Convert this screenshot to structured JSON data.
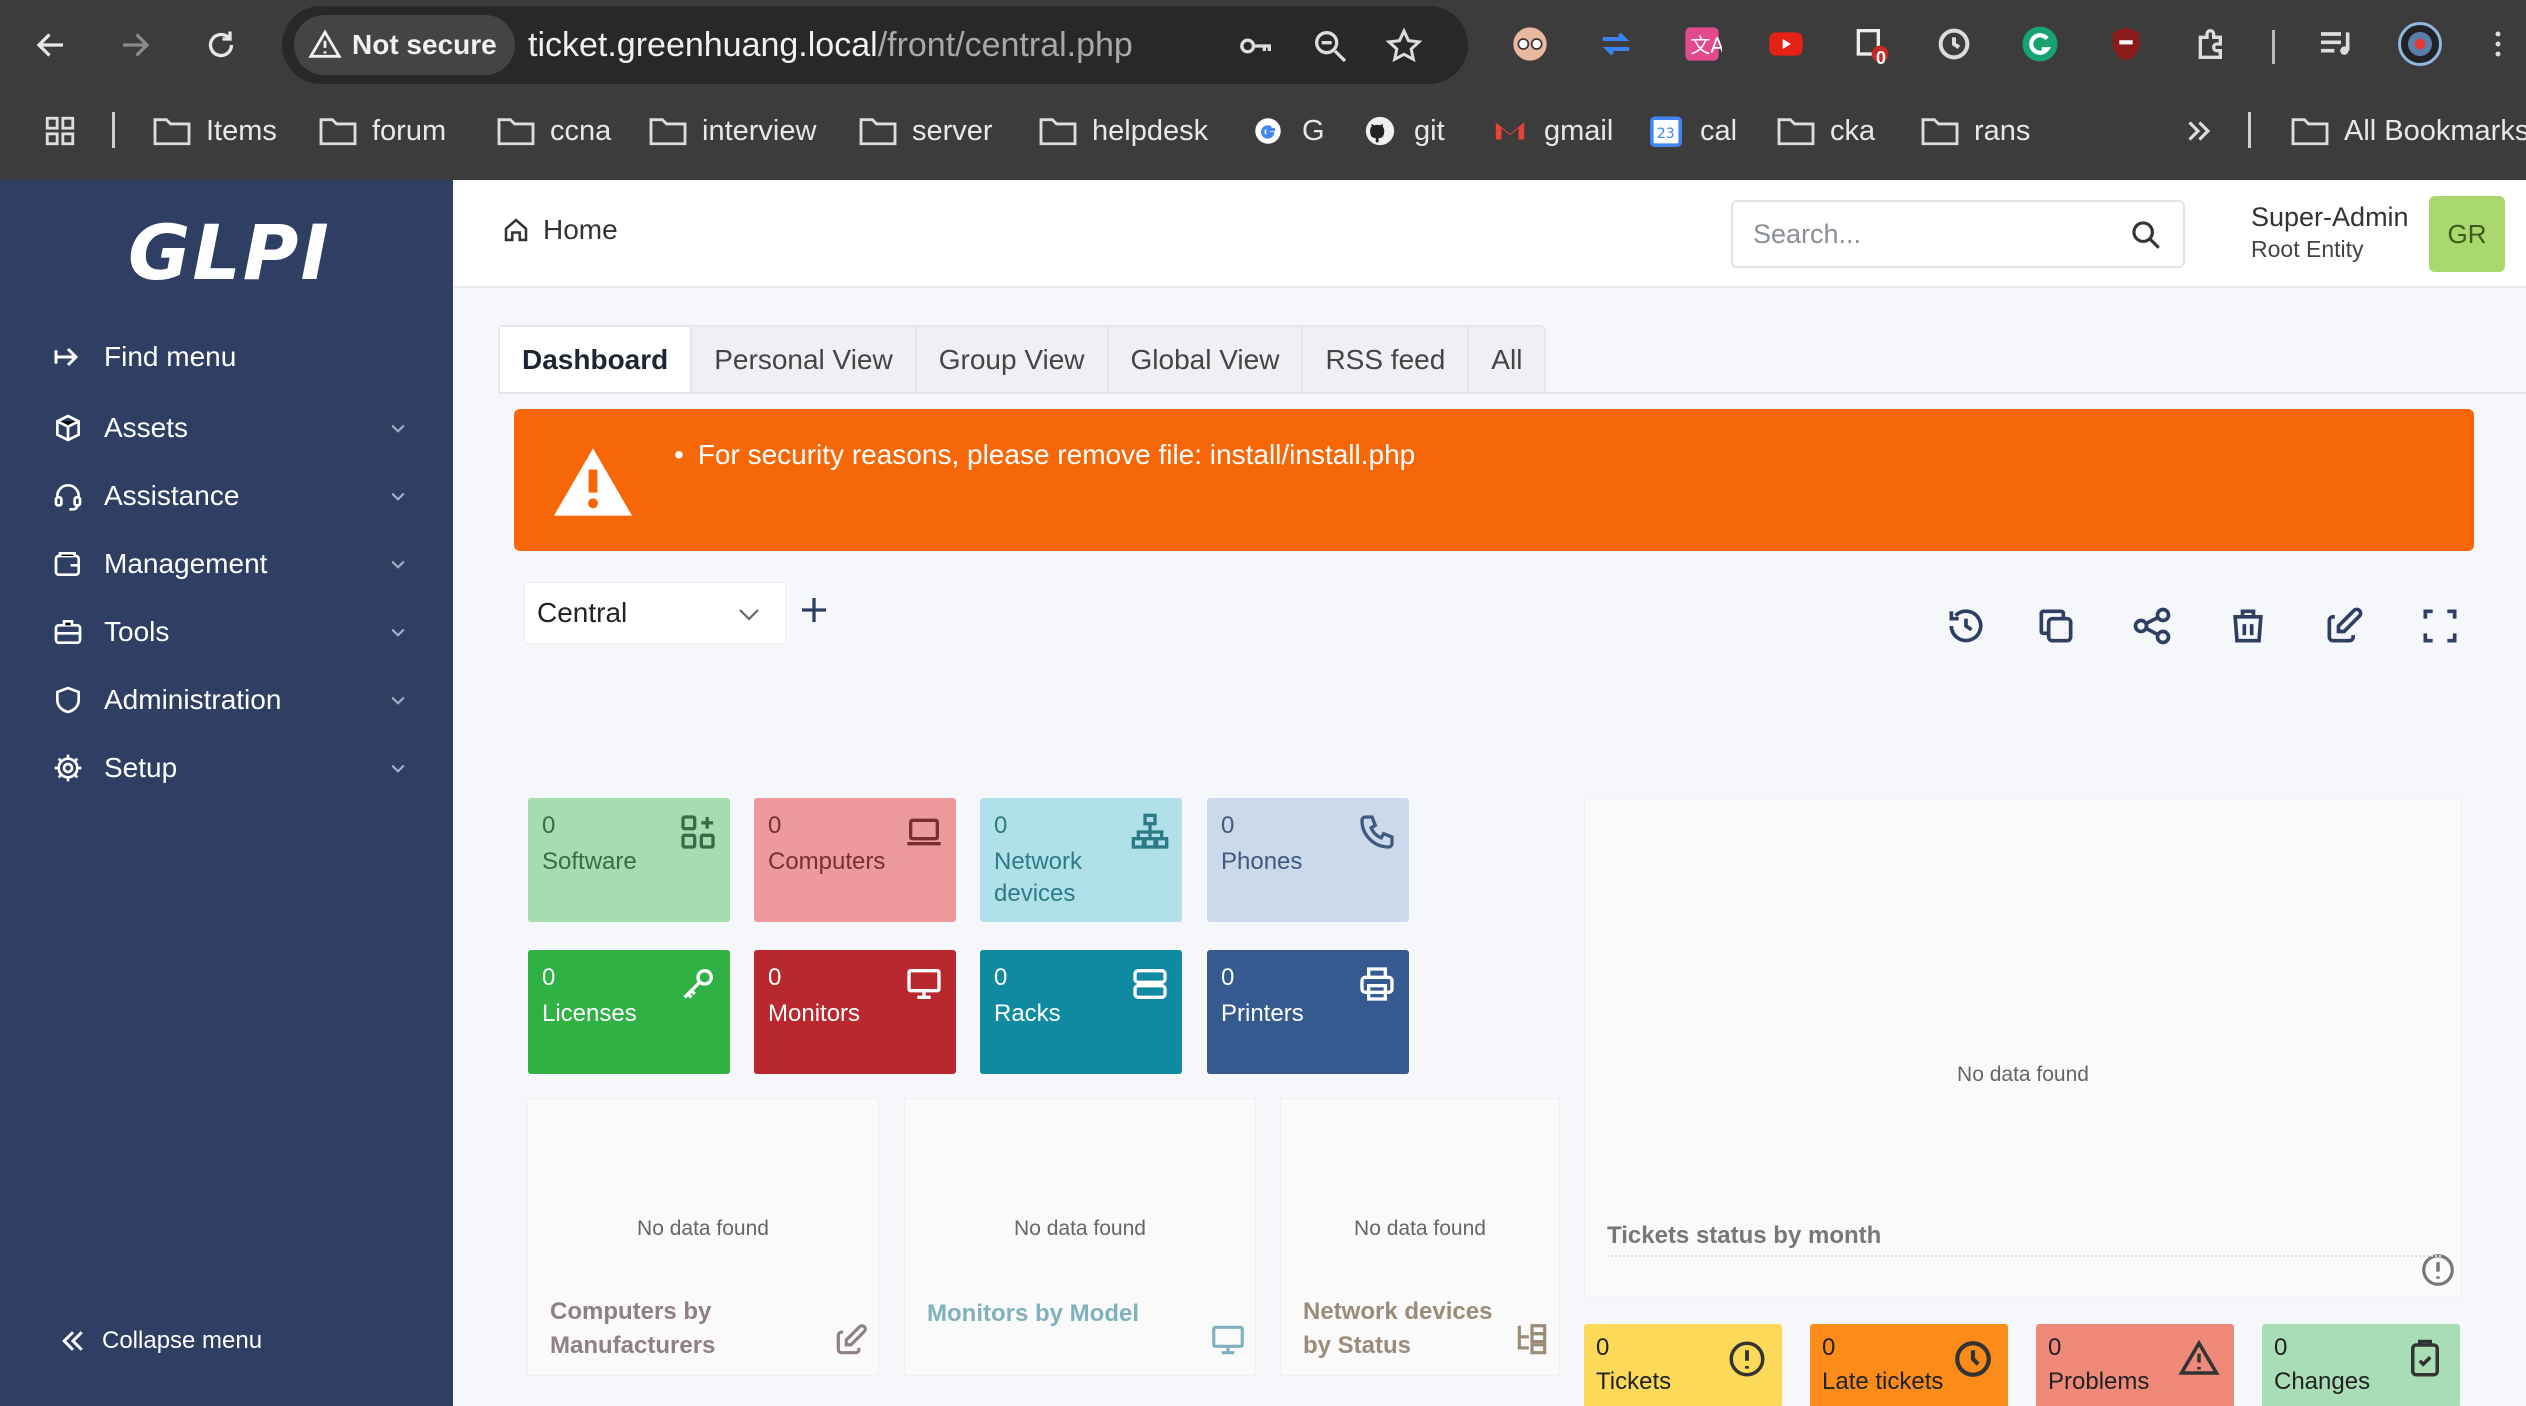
{
  "browser": {
    "security_label": "Not secure",
    "url_host": "ticket.greenhuang.local",
    "url_path": "/front/central.php",
    "ext_badge": "0",
    "bookmarks": [
      {
        "label": "Items",
        "icon": "folder-icon"
      },
      {
        "label": "forum",
        "icon": "folder-icon"
      },
      {
        "label": "ccna",
        "icon": "folder-icon"
      },
      {
        "label": "interview",
        "icon": "folder-icon"
      },
      {
        "label": "server",
        "icon": "folder-icon"
      },
      {
        "label": "helpdesk",
        "icon": "folder-icon"
      },
      {
        "label": "G",
        "icon": "google-icon"
      },
      {
        "label": "git",
        "icon": "github-icon"
      },
      {
        "label": "gmail",
        "icon": "gmail-icon"
      },
      {
        "label": "cal",
        "icon": "calendar-icon"
      },
      {
        "label": "cka",
        "icon": "folder-icon"
      },
      {
        "label": "rans",
        "icon": "folder-icon"
      }
    ],
    "all_bookmarks": "All Bookmarks",
    "calendar_day": "23"
  },
  "app": {
    "logo": "GLPI",
    "sidebar": {
      "items": [
        {
          "label": "Find menu",
          "icon": "arrow-right-icon",
          "expandable": false
        },
        {
          "label": "Assets",
          "icon": "cube-icon",
          "expandable": true
        },
        {
          "label": "Assistance",
          "icon": "headset-icon",
          "expandable": true
        },
        {
          "label": "Management",
          "icon": "wallet-icon",
          "expandable": true
        },
        {
          "label": "Tools",
          "icon": "briefcase-icon",
          "expandable": true
        },
        {
          "label": "Administration",
          "icon": "shield-icon",
          "expandable": true
        },
        {
          "label": "Setup",
          "icon": "gear-icon",
          "expandable": true
        }
      ],
      "collapse_label": "Collapse menu"
    },
    "header": {
      "breadcrumb": "Home",
      "search_placeholder": "Search...",
      "user_name": "Super-Admin",
      "user_entity": "Root Entity",
      "avatar_initials": "GR"
    },
    "tabs": [
      "Dashboard",
      "Personal View",
      "Group View",
      "Global View",
      "RSS feed",
      "All"
    ],
    "active_tab": "Dashboard",
    "alert": {
      "message": "For security reasons, please remove file: install/install.php",
      "color": "#f76707"
    },
    "dashboard": {
      "selected": "Central",
      "tools": [
        "history-icon",
        "copy-icon",
        "share-icon",
        "trash-icon",
        "edit-icon",
        "fullscreen-icon"
      ],
      "cards": [
        {
          "value": "0",
          "label": "Software",
          "bg": "#a6ddb0",
          "fg": "#3b6b46",
          "icon": "apps-add-icon"
        },
        {
          "value": "0",
          "label": "Computers",
          "bg": "#ec9a9b",
          "fg": "#7a2e30",
          "icon": "laptop-icon"
        },
        {
          "value": "0",
          "label": "Network devices",
          "bg": "#b1e1e8",
          "fg": "#2d7a88",
          "icon": "network-icon"
        },
        {
          "value": "0",
          "label": "Phones",
          "bg": "#cbd9ea",
          "fg": "#3f5a80",
          "icon": "phone-icon"
        },
        {
          "value": "0",
          "label": "Licenses",
          "bg": "#2fb144",
          "fg": "#ffffff",
          "icon": "key-icon"
        },
        {
          "value": "0",
          "label": "Monitors",
          "bg": "#b9282e",
          "fg": "#ffffff",
          "icon": "monitor-icon"
        },
        {
          "value": "0",
          "label": "Racks",
          "bg": "#108aa0",
          "fg": "#ffffff",
          "icon": "server-icon"
        },
        {
          "value": "0",
          "label": "Printers",
          "bg": "#345a8f",
          "fg": "#ffffff",
          "icon": "printer-icon"
        }
      ],
      "widgets": [
        {
          "title": "Computers by Manufacturers",
          "nodata": "No data found",
          "fg": "#8f7f86",
          "icon": "edit-icon"
        },
        {
          "title": "Monitors by Model",
          "nodata": "No data found",
          "fg": "#7fb2be",
          "icon": "monitor-icon"
        },
        {
          "title": "Network devices by Status",
          "nodata": "No data found",
          "fg": "#9b8c7a",
          "icon": "tree-icon"
        },
        {
          "title": "Tickets status by month",
          "nodata": "No data found",
          "fg": "#777777",
          "icon": "info-icon"
        }
      ],
      "ticket_cards": [
        {
          "value": "0",
          "label": "Tickets",
          "bg": "#fcd958",
          "icon": "alert-circle-icon"
        },
        {
          "value": "0",
          "label": "Late tickets",
          "bg": "#fb8c1a",
          "icon": "clock-icon"
        },
        {
          "value": "0",
          "label": "Problems",
          "bg": "#ef8a7b",
          "icon": "warning-icon"
        },
        {
          "value": "0",
          "label": "Changes",
          "bg": "#a9ddb5",
          "icon": "clipboard-check-icon"
        }
      ]
    }
  }
}
